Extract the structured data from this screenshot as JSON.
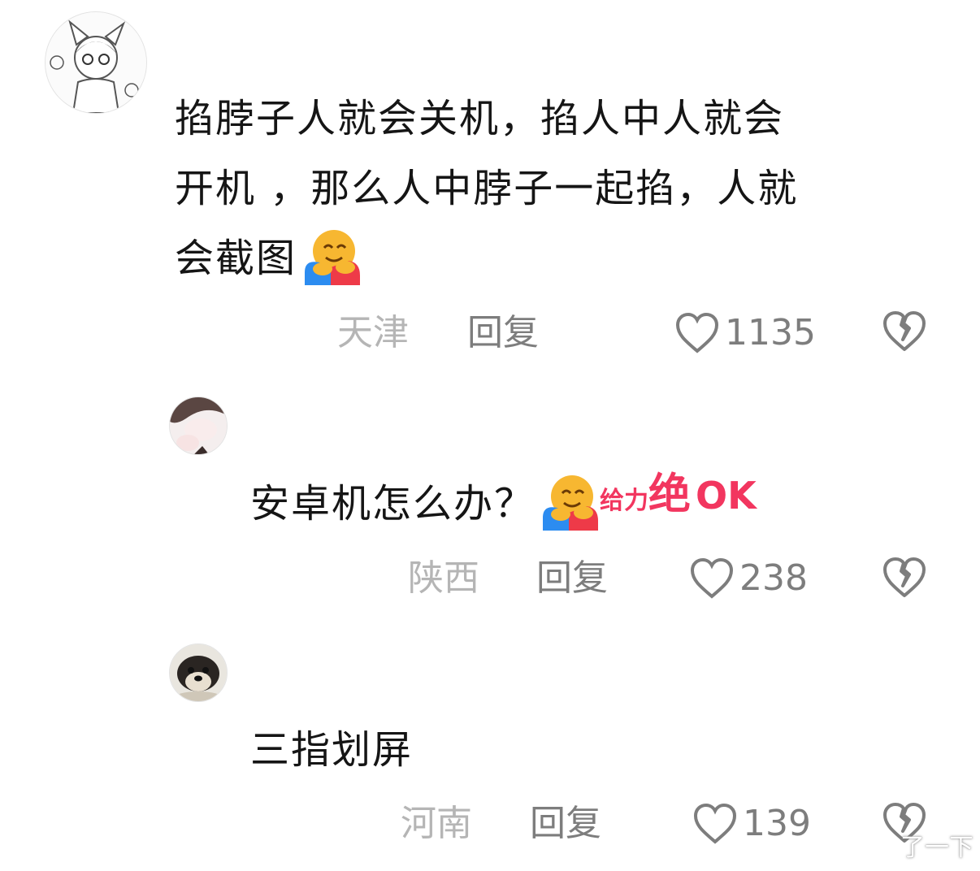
{
  "comments": [
    {
      "text_lines": [
        "掐脖子人就会关机，掐人中人就会",
        "开机 ，那么人中脖子一起掐，人就",
        "会截图"
      ],
      "emoji": "hugging-face-emoji",
      "location": "天津",
      "reply_label": "回复",
      "likes": "1135"
    },
    {
      "text": "安卓机怎么办？",
      "emoji": "hugging-face-emoji",
      "sticker": {
        "part1": "给力",
        "part2": "绝",
        "part3": "OK"
      },
      "location": "陕西",
      "reply_label": "回复",
      "likes": "238"
    },
    {
      "text": "三指划屏",
      "location": "河南",
      "reply_label": "回复",
      "likes": "139"
    }
  ],
  "watermark": "了一下",
  "colors": {
    "sticker": "#f2365f",
    "location": "#b5b5b5",
    "meta": "#7d7d7d"
  }
}
